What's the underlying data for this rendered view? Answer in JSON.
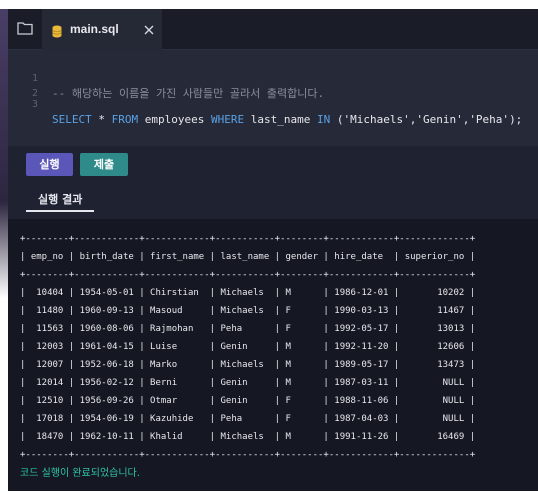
{
  "tab": {
    "filename": "main.sql"
  },
  "editor": {
    "lines": [
      {
        "num": "1",
        "comment": "-- 해당하는 이름을 가진 사람들만 골라서 출력합니다."
      },
      {
        "num": "2",
        "comment": ""
      },
      {
        "num": "3",
        "sql": {
          "select": "SELECT",
          "star": "*",
          "from": "FROM",
          "table": "employees",
          "where": "WHERE",
          "column": "last_name",
          "in": "IN",
          "open": "(",
          "v1": "'Michaels'",
          "c1": ",",
          "v2": "'Genin'",
          "c2": ",",
          "v3": "'Peha'",
          "close": ");"
        }
      }
    ]
  },
  "toolbar": {
    "run_label": "실행",
    "submit_label": "제출"
  },
  "result_tab": {
    "label": "실행 결과"
  },
  "result": {
    "border": "+--------+------------+------------+-----------+--------+------------+-------------+",
    "columns": [
      "emp_no",
      "birth_date",
      "first_name",
      "last_name",
      "gender",
      "hire_date",
      "superior_no"
    ],
    "rows": [
      [
        "10404",
        "1954-05-01",
        "Chirstian",
        "Michaels",
        "M",
        "1986-12-01",
        "10202"
      ],
      [
        "11480",
        "1960-09-13",
        "Masoud",
        "Michaels",
        "F",
        "1990-03-13",
        "11467"
      ],
      [
        "11563",
        "1960-08-06",
        "Rajmohan",
        "Peha",
        "F",
        "1992-05-17",
        "13013"
      ],
      [
        "12003",
        "1961-04-15",
        "Luise",
        "Genin",
        "M",
        "1992-11-20",
        "12606"
      ],
      [
        "12007",
        "1952-06-18",
        "Marko",
        "Michaels",
        "M",
        "1989-05-17",
        "13473"
      ],
      [
        "12014",
        "1956-02-12",
        "Berni",
        "Genin",
        "M",
        "1987-03-11",
        "NULL"
      ],
      [
        "12510",
        "1956-09-26",
        "Otmar",
        "Genin",
        "F",
        "1988-11-06",
        "NULL"
      ],
      [
        "17018",
        "1954-06-19",
        "Kazuhide",
        "Peha",
        "F",
        "1987-04-03",
        "NULL"
      ],
      [
        "18470",
        "1962-10-11",
        "Khalid",
        "Michaels",
        "M",
        "1991-11-26",
        "16469"
      ]
    ],
    "status": "코드 실행이 완료되었습니다."
  }
}
